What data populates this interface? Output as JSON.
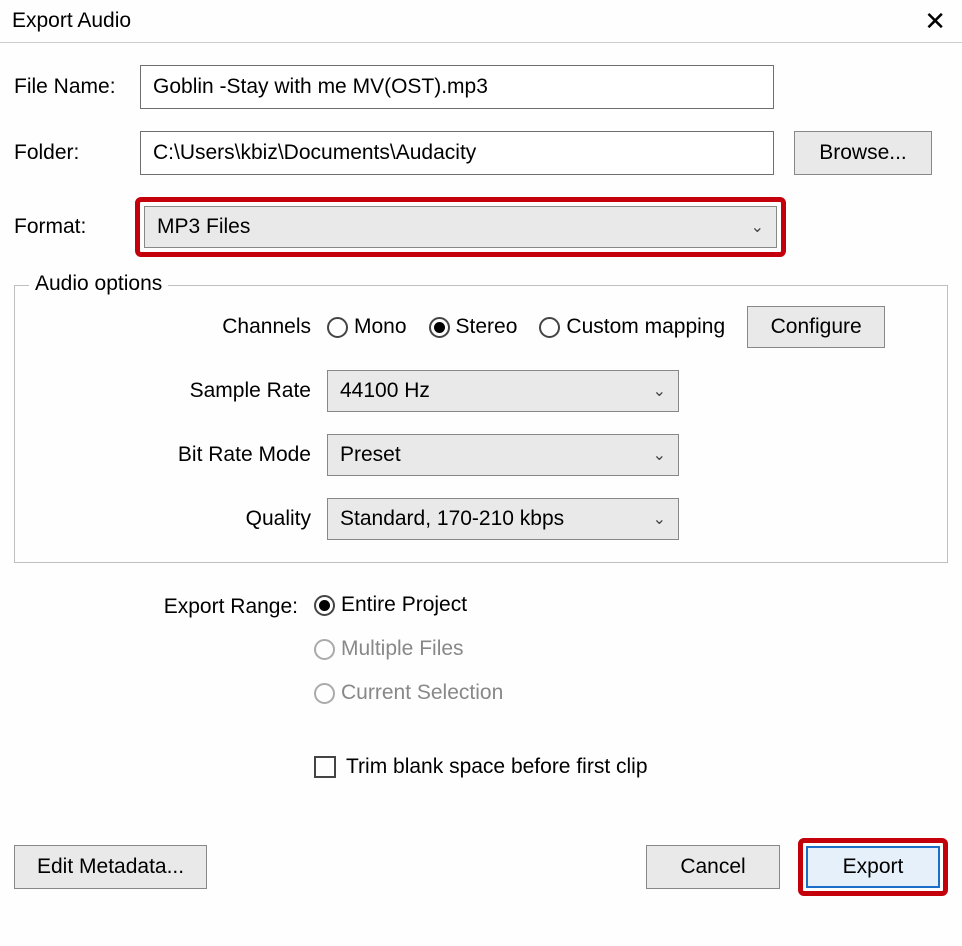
{
  "title": "Export Audio",
  "labels": {
    "file_name": "File Name:",
    "folder": "Folder:",
    "format": "Format:",
    "browse": "Browse...",
    "audio_options": "Audio options",
    "channels": "Channels",
    "configure": "Configure",
    "sample_rate": "Sample Rate",
    "bit_rate_mode": "Bit Rate Mode",
    "quality": "Quality",
    "export_range": "Export Range:",
    "trim": "Trim blank space before first clip",
    "edit_metadata": "Edit Metadata...",
    "cancel": "Cancel",
    "export": "Export"
  },
  "values": {
    "file_name": "Goblin -Stay with me MV(OST).mp3",
    "folder": "C:\\Users\\kbiz\\Documents\\Audacity",
    "format": "MP3 Files",
    "sample_rate": "44100 Hz",
    "bit_rate_mode": "Preset",
    "quality": "Standard, 170-210 kbps"
  },
  "channels": {
    "mono": "Mono",
    "stereo": "Stereo",
    "custom": "Custom mapping"
  },
  "export_range": {
    "entire": "Entire Project",
    "multiple": "Multiple Files",
    "current": "Current Selection"
  }
}
